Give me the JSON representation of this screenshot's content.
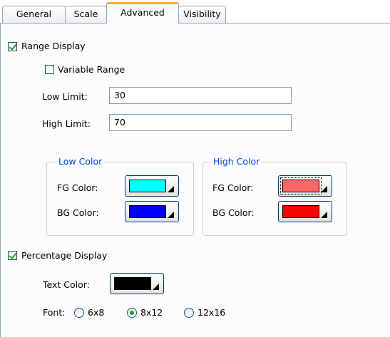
{
  "tabs": [
    {
      "label": "General"
    },
    {
      "label": "Scale"
    },
    {
      "label": "Advanced"
    },
    {
      "label": "Visibility"
    }
  ],
  "active_tab": "Advanced",
  "range_display": {
    "label": "Range Display",
    "checked": true
  },
  "variable_range": {
    "label": "Variable Range",
    "checked": false
  },
  "low_limit": {
    "label": "Low Limit:",
    "value": "30"
  },
  "high_limit": {
    "label": "High Limit:",
    "value": "70"
  },
  "low_color": {
    "title": "Low Color",
    "fg_label": "FG Color:",
    "fg_color": "#00ffff",
    "bg_label": "BG Color:",
    "bg_color": "#0000ff"
  },
  "high_color": {
    "title": "High Color",
    "fg_label": "FG Color:",
    "fg_color": "#ff6666",
    "bg_label": "BG Color:",
    "bg_color": "#ff0000"
  },
  "percentage_display": {
    "label": "Percentage Display",
    "checked": true
  },
  "text_color": {
    "label": "Text Color:",
    "color": "#000000"
  },
  "font": {
    "label": "Font:",
    "options": [
      {
        "label": "6x8",
        "selected": false
      },
      {
        "label": "8x12",
        "selected": true
      },
      {
        "label": "12x16",
        "selected": false
      }
    ]
  }
}
